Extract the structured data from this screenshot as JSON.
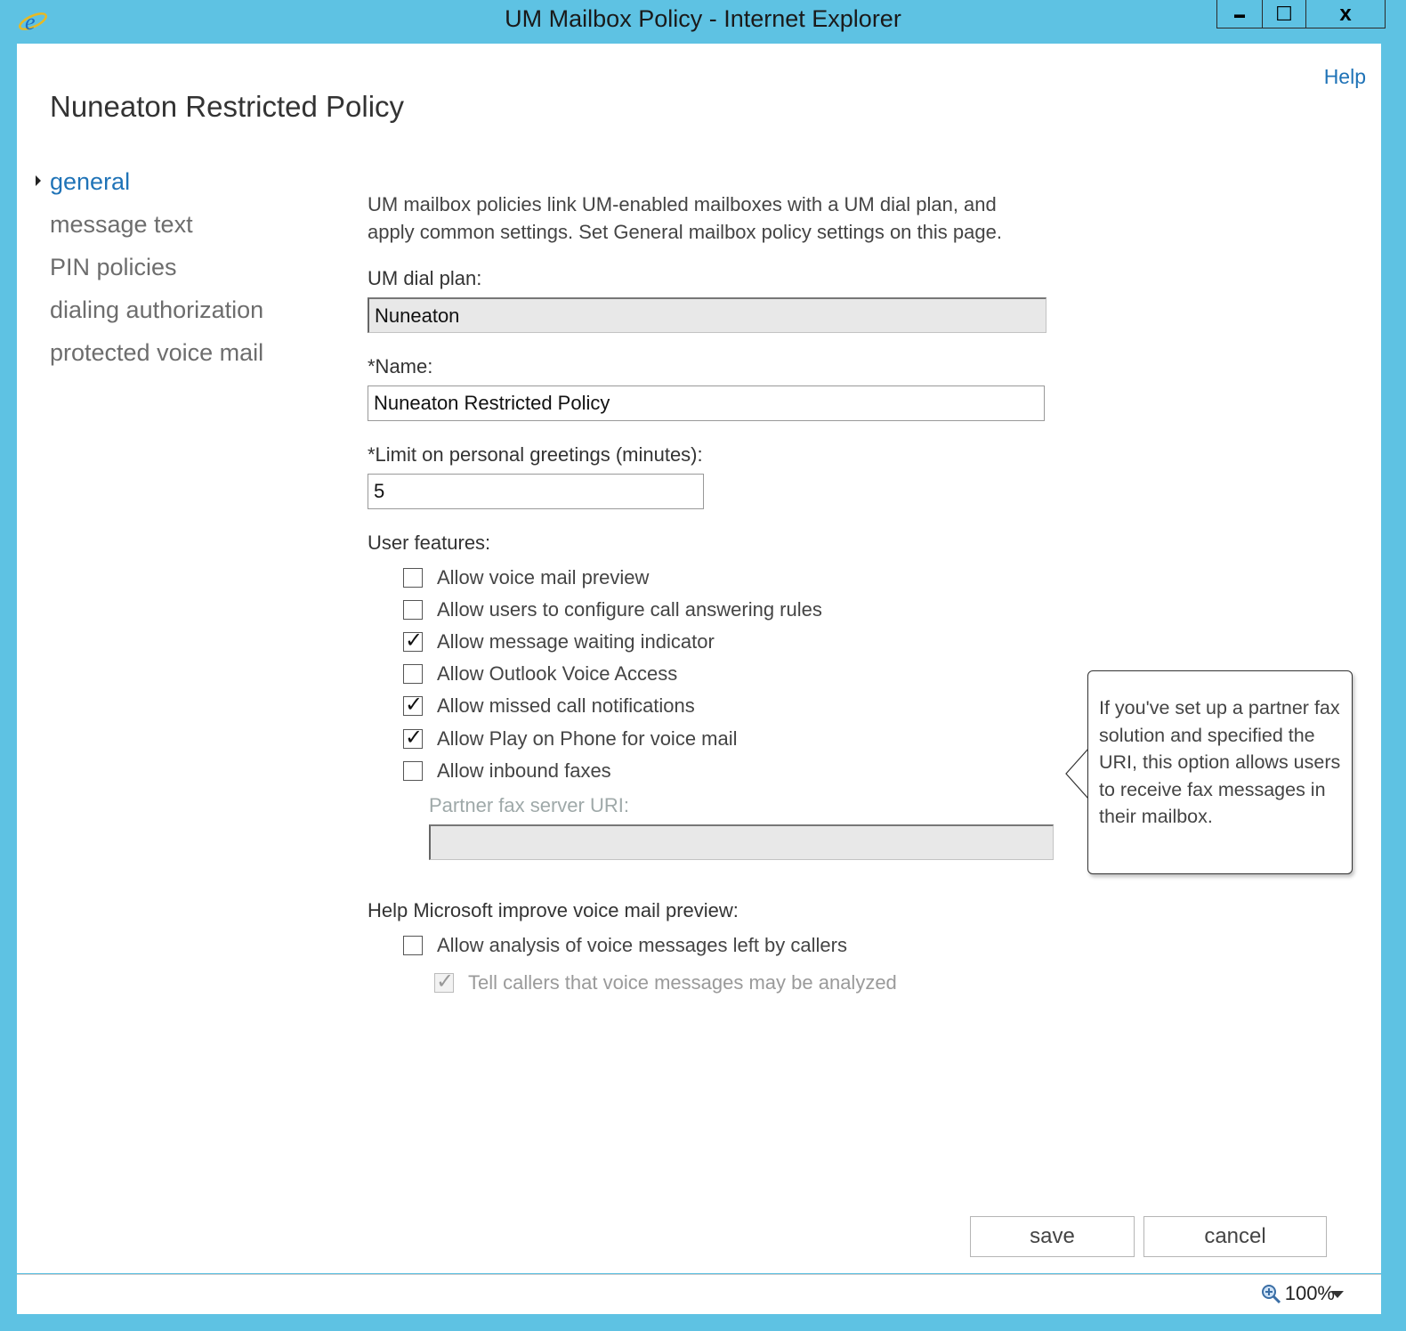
{
  "window": {
    "title": "UM Mailbox Policy - Internet Explorer",
    "controls": {
      "minimize": "▬",
      "maximize": "☐",
      "close": "x"
    }
  },
  "header": {
    "help_label": "Help",
    "page_title": "Nuneaton Restricted Policy"
  },
  "nav": {
    "items": [
      {
        "label": "general",
        "active": true
      },
      {
        "label": "message text"
      },
      {
        "label": "PIN policies"
      },
      {
        "label": "dialing authorization"
      },
      {
        "label": "protected voice mail"
      }
    ]
  },
  "form": {
    "description": "UM mailbox policies link UM-enabled mailboxes with a UM dial plan, and apply common settings. Set General mailbox policy settings on this page.",
    "dial_plan_label": "UM dial plan:",
    "dial_plan_value": "Nuneaton",
    "name_label": "*Name:",
    "name_value": "Nuneaton Restricted Policy",
    "greeting_label": "*Limit on personal greetings (minutes):",
    "greeting_value": "5",
    "user_features_label": "User features:",
    "features": [
      {
        "label": "Allow voice mail preview",
        "checked": false
      },
      {
        "label": "Allow users to configure call answering rules",
        "checked": false
      },
      {
        "label": "Allow message waiting indicator",
        "checked": true
      },
      {
        "label": "Allow Outlook Voice Access",
        "checked": false
      },
      {
        "label": "Allow missed call notifications",
        "checked": true
      },
      {
        "label": "Allow Play on Phone for voice mail",
        "checked": true
      },
      {
        "label": "Allow inbound faxes",
        "checked": false
      }
    ],
    "fax_uri_label": "Partner fax server URI:",
    "fax_uri_value": "",
    "improve_label": "Help Microsoft improve voice mail preview:",
    "analysis": {
      "label": "Allow analysis of voice messages left by callers",
      "checked": false
    },
    "tell_callers": {
      "label": "Tell callers that voice messages may be analyzed",
      "checked": true,
      "disabled": true
    }
  },
  "callout": {
    "text": "If you've set up a partner fax solution and specified the URI, this option allows users to receive fax messages in their mailbox."
  },
  "buttons": {
    "save": "save",
    "cancel": "cancel"
  },
  "status": {
    "zoom": "100%"
  },
  "colors": {
    "frame": "#5ec2e3",
    "accent": "#1f73b7"
  }
}
